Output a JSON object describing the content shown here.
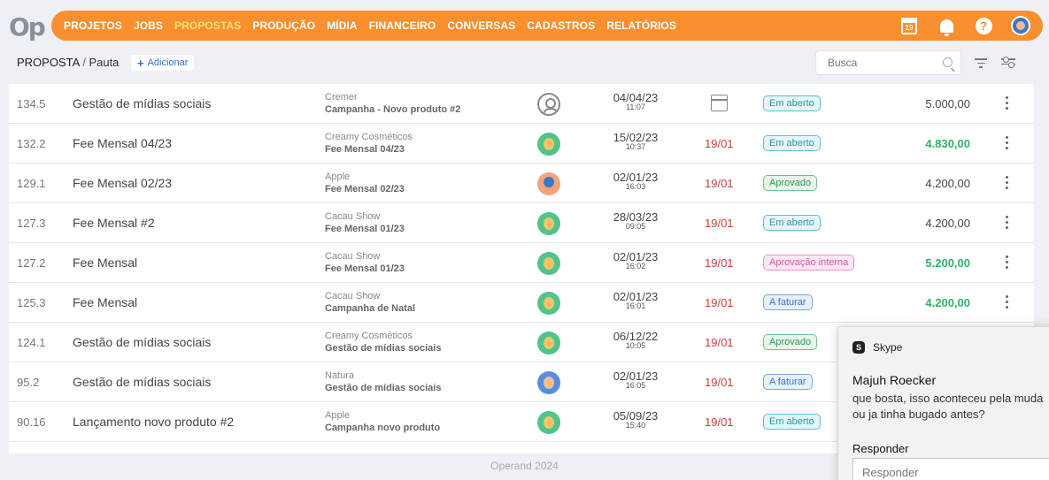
{
  "logo": "Op",
  "nav": {
    "items": [
      "PROJETOS",
      "JOBS",
      "PROPOSTAS",
      "PRODUÇÃO",
      "MÍDIA",
      "FINANCEIRO",
      "CONVERSAS",
      "CADASTROS",
      "RELATÓRIOS"
    ],
    "active": "PROPOSTAS",
    "calendar_day": "19"
  },
  "breadcrumb": {
    "section": "PROPOSTA",
    "separator": "/",
    "page": "Pauta"
  },
  "add_button": {
    "icon": "+",
    "label": "Adicionar"
  },
  "search": {
    "placeholder": "Busca"
  },
  "rows": [
    {
      "code": "134.5",
      "title": "Gestão de mídias sociais",
      "client": "Cremer",
      "project": "Campanha - Novo produto #2",
      "avatar": "placeholder",
      "date": "04/04/23",
      "time": "11:07",
      "deadline": "",
      "status": "Em aberto",
      "status_kind": "aberto",
      "value": "5.000,00",
      "value_green": false
    },
    {
      "code": "132.2",
      "title": "Fee Mensal 04/23",
      "client": "Creamy Cosméticos",
      "project": "Fee Mensal 04/23",
      "avatar": "green",
      "date": "15/02/23",
      "time": "10:37",
      "deadline": "19/01",
      "status": "Em aberto",
      "status_kind": "aberto",
      "value": "4.830,00",
      "value_green": true
    },
    {
      "code": "129.1",
      "title": "Fee Mensal 02/23",
      "client": "Apple",
      "project": "Fee Mensal 02/23",
      "avatar": "orange",
      "date": "02/01/23",
      "time": "16:03",
      "deadline": "19/01",
      "status": "Aprovado",
      "status_kind": "aprovado",
      "value": "4.200,00",
      "value_green": false
    },
    {
      "code": "127.3",
      "title": "Fee Mensal #2",
      "client": "Cacau Show",
      "project": "Fee Mensal 01/23",
      "avatar": "green",
      "date": "28/03/23",
      "time": "09:05",
      "deadline": "19/01",
      "status": "Em aberto",
      "status_kind": "aberto",
      "value": "4.200,00",
      "value_green": false
    },
    {
      "code": "127.2",
      "title": "Fee Mensal",
      "client": "Cacau Show",
      "project": "Fee Mensal 01/23",
      "avatar": "green",
      "date": "02/01/23",
      "time": "16:02",
      "deadline": "19/01",
      "status": "Aprovação interna",
      "status_kind": "interna",
      "value": "5.200,00",
      "value_green": true
    },
    {
      "code": "125.3",
      "title": "Fee Mensal",
      "client": "Cacau Show",
      "project": "Campanha de Natal",
      "avatar": "green",
      "date": "02/01/23",
      "time": "16:01",
      "deadline": "19/01",
      "status": "A faturar",
      "status_kind": "faturar",
      "value": "4.200,00",
      "value_green": true
    },
    {
      "code": "124.1",
      "title": "Gestão de mídias sociais",
      "client": "Creamy Cosméticos",
      "project": "Gestão de mídias sociais",
      "avatar": "green",
      "date": "06/12/22",
      "time": "10:05",
      "deadline": "19/01",
      "status": "Aprovado",
      "status_kind": "aprovado",
      "value": "",
      "value_green": false
    },
    {
      "code": "95.2",
      "title": "Gestão de mídias sociais",
      "client": "Natura",
      "project": "Gestão de mídias sociais",
      "avatar": "blue",
      "date": "02/01/23",
      "time": "16:05",
      "deadline": "19/01",
      "status": "A faturar",
      "status_kind": "faturar",
      "value": "",
      "value_green": false
    },
    {
      "code": "90.16",
      "title": "Lançamento novo produto #2",
      "client": "Apple",
      "project": "Campanha novo produto",
      "avatar": "green",
      "date": "05/09/23",
      "time": "15:40",
      "deadline": "19/01",
      "status": "Em aberto",
      "status_kind": "aberto",
      "value": "",
      "value_green": false
    }
  ],
  "footer": "Operand 2024",
  "skype": {
    "app": "Skype",
    "sender": "Majuh Roecker",
    "message_line1": "que bosta, isso aconteceu pela muda",
    "message_line2": "ou ja tinha bugado antes?",
    "reply_label": "Responder",
    "reply_placeholder": "Responder"
  }
}
